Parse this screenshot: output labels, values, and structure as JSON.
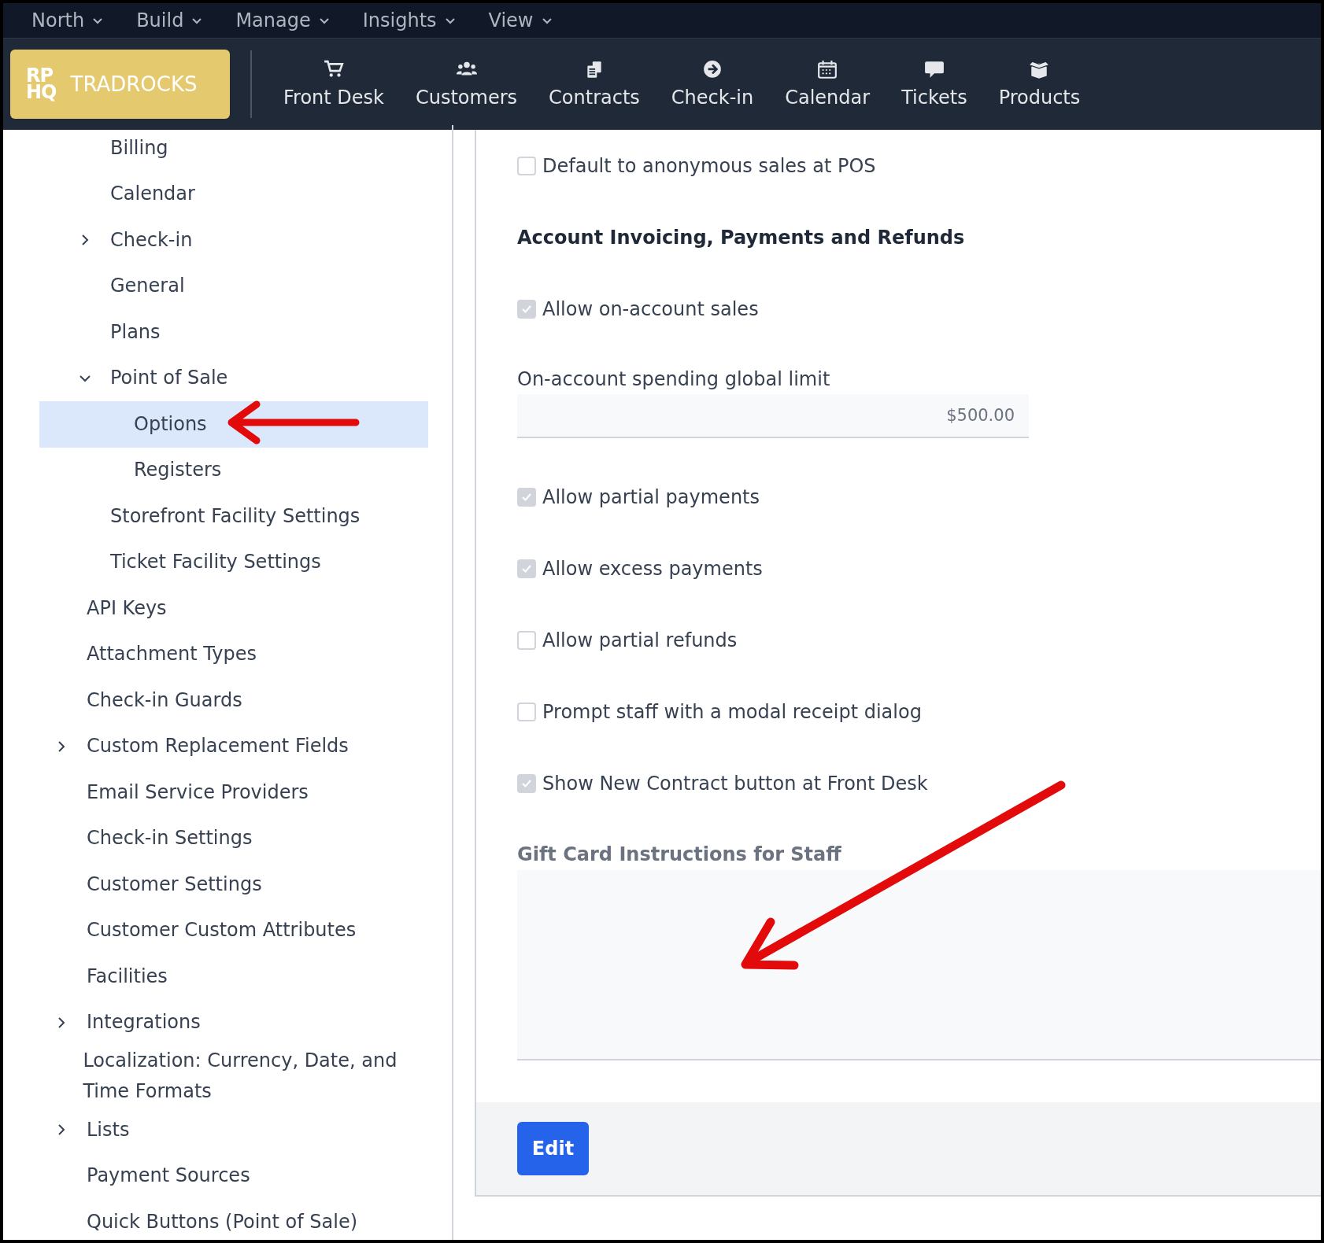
{
  "menu_bar": [
    {
      "label": "North"
    },
    {
      "label": "Build"
    },
    {
      "label": "Manage"
    },
    {
      "label": "Insights"
    },
    {
      "label": "View"
    }
  ],
  "logo": {
    "mark_top": "RP",
    "mark_bottom": "HQ",
    "name": "TRADROCKS"
  },
  "nav": [
    {
      "label": "Front Desk"
    },
    {
      "label": "Customers"
    },
    {
      "label": "Contracts"
    },
    {
      "label": "Check-in"
    },
    {
      "label": "Calendar"
    },
    {
      "label": "Tickets"
    },
    {
      "label": "Products"
    }
  ],
  "sidebar": {
    "partial_group_items": [
      {
        "label": "Billing",
        "selected": false
      },
      {
        "label": "Calendar",
        "selected": false
      },
      {
        "label": "Check-in",
        "selected": false,
        "expanded": false
      },
      {
        "label": "General",
        "selected": false
      },
      {
        "label": "Plans",
        "selected": false
      },
      {
        "label": "Point of Sale",
        "selected": false,
        "expanded": true,
        "children": [
          {
            "label": "Options",
            "selected": true
          },
          {
            "label": "Registers",
            "selected": false
          }
        ]
      },
      {
        "label": "Storefront Facility Settings",
        "selected": false
      },
      {
        "label": "Ticket Facility Settings",
        "selected": false
      }
    ],
    "items": [
      {
        "label": "API Keys",
        "selected": false
      },
      {
        "label": "Attachment Types",
        "selected": false
      },
      {
        "label": "Check-in Guards",
        "selected": false
      },
      {
        "label": "Custom Replacement Fields",
        "selected": false,
        "expanded": false
      },
      {
        "label": "Email Service Providers",
        "selected": false
      },
      {
        "label": "Check-in Settings",
        "selected": false
      },
      {
        "label": "Customer Settings",
        "selected": false
      },
      {
        "label": "Customer Custom Attributes",
        "selected": false
      },
      {
        "label": "Facilities",
        "selected": false
      },
      {
        "label": "Integrations",
        "selected": false,
        "expanded": false
      },
      {
        "label": "Localization: Currency, Date, and Time Formats",
        "selected": false
      },
      {
        "label": "Lists",
        "selected": false,
        "expanded": false
      },
      {
        "label": "Payment Sources",
        "selected": false
      },
      {
        "label": "Quick Buttons (Point of Sale)",
        "selected": false
      }
    ]
  },
  "form": {
    "fields": [
      {
        "kind": "checkbox",
        "label": "Default to anonymous sales at POS",
        "checked": false
      },
      {
        "kind": "heading",
        "label": "Account Invoicing, Payments and Refunds"
      },
      {
        "kind": "checkbox",
        "label": "Allow on-account sales",
        "checked": true
      },
      {
        "kind": "input",
        "label": "On-account spending global limit",
        "value": "$500.00"
      },
      {
        "kind": "checkbox",
        "label": "Allow partial payments",
        "checked": true
      },
      {
        "kind": "checkbox",
        "label": "Allow excess payments",
        "checked": true
      },
      {
        "kind": "checkbox",
        "label": "Allow partial refunds",
        "checked": false
      },
      {
        "kind": "checkbox",
        "label": "Prompt staff with a modal receipt dialog",
        "checked": false
      },
      {
        "kind": "checkbox",
        "label": "Show New Contract button at Front Desk",
        "checked": true
      },
      {
        "kind": "textarea",
        "label": "Gift Card Instructions for Staff"
      }
    ],
    "buttons": [
      {
        "label": "Edit"
      }
    ]
  }
}
